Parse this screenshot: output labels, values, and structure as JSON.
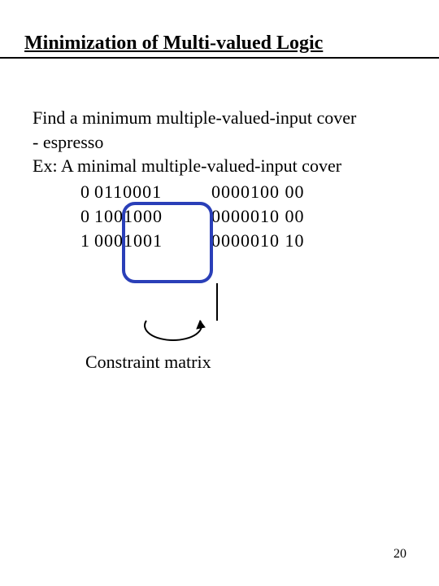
{
  "title": "Minimization of Multi-valued Logic",
  "lines": {
    "l1": "Find a minimum multiple-valued-input cover",
    "l2": "- espresso",
    "l3": "Ex: A minimal multiple-valued-input cover"
  },
  "rows": [
    {
      "a": "0",
      "b": "0110001",
      "c": "0000100 00"
    },
    {
      "a": "0",
      "b": "1001000",
      "c": "0000010 00"
    },
    {
      "a": "1",
      "b": "0001001",
      "c": "0000010 10"
    }
  ],
  "constraint_label": "Constraint matrix",
  "page_number": "20"
}
